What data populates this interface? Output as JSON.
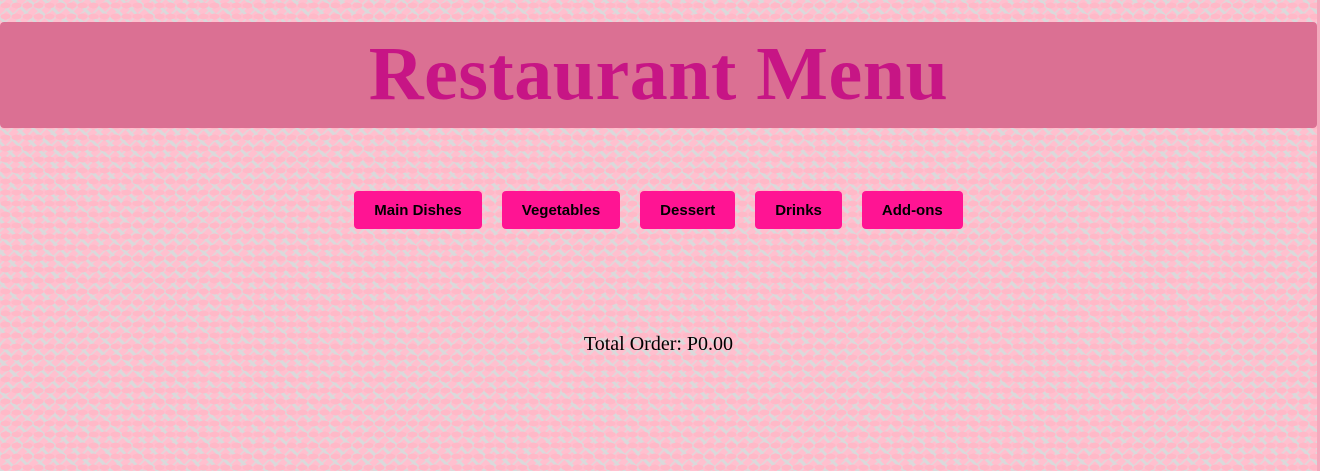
{
  "header": {
    "title": "Restaurant Menu"
  },
  "nav": {
    "items": [
      {
        "label": "Main Dishes"
      },
      {
        "label": "Vegetables"
      },
      {
        "label": "Dessert"
      },
      {
        "label": "Drinks"
      },
      {
        "label": "Add-ons"
      }
    ]
  },
  "order": {
    "total_label": "Total Order: P0.00"
  },
  "colors": {
    "header_bg": "#db7093",
    "title": "#c71585",
    "button_bg": "#ff1493",
    "page_bg": "#ffc0cb"
  }
}
